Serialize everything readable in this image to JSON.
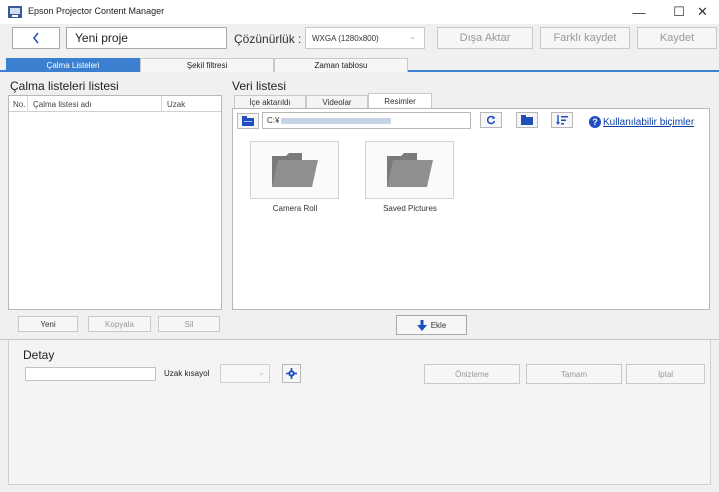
{
  "window": {
    "title": "Epson Projector Content Manager",
    "minimize": "—",
    "maximize": "☐",
    "close": "✕"
  },
  "toolbar": {
    "back": "‹",
    "project_name": "Yeni proje",
    "resolution_label": "Çözünürlük :",
    "resolution_value": "WXGA (1280x800)",
    "export": "Dışa Aktar",
    "save_as": "Farklı kaydet",
    "save": "Kaydet"
  },
  "tabs": [
    {
      "label": "Çalma Listeleri",
      "active": true
    },
    {
      "label": "Şekil filtresi",
      "active": false
    },
    {
      "label": "Zaman tablosu",
      "active": false
    }
  ],
  "playlists": {
    "title": "Çalma listeleri listesi",
    "columns": [
      "No.",
      "Çalma listesi adı",
      "Uzak"
    ],
    "rows": [],
    "new": "Yeni",
    "copy": "Kopyala",
    "delete": "Sil"
  },
  "data_list": {
    "title": "Veri listesi",
    "tabs": [
      {
        "label": "İçe aktarıldı",
        "active": false
      },
      {
        "label": "Videolar",
        "active": false
      },
      {
        "label": "Resimler",
        "active": true
      }
    ],
    "path_prefix": "C:¥",
    "formats_link": "Kullanılabilir biçimler",
    "folders": [
      {
        "name": "Camera Roll",
        "icon": "folder-icon"
      },
      {
        "name": "Saved Pictures",
        "icon": "folder-icon"
      }
    ],
    "add": "Ekle"
  },
  "detail": {
    "title": "Detay",
    "remote_shortcut_label": "Uzak kısayol",
    "preview": "Önizleme",
    "ok": "Tamam",
    "cancel": "İptal"
  },
  "colors": {
    "accent": "#3a7fd0",
    "link": "#0a3fa6",
    "icon_blue": "#1f4fbf"
  }
}
